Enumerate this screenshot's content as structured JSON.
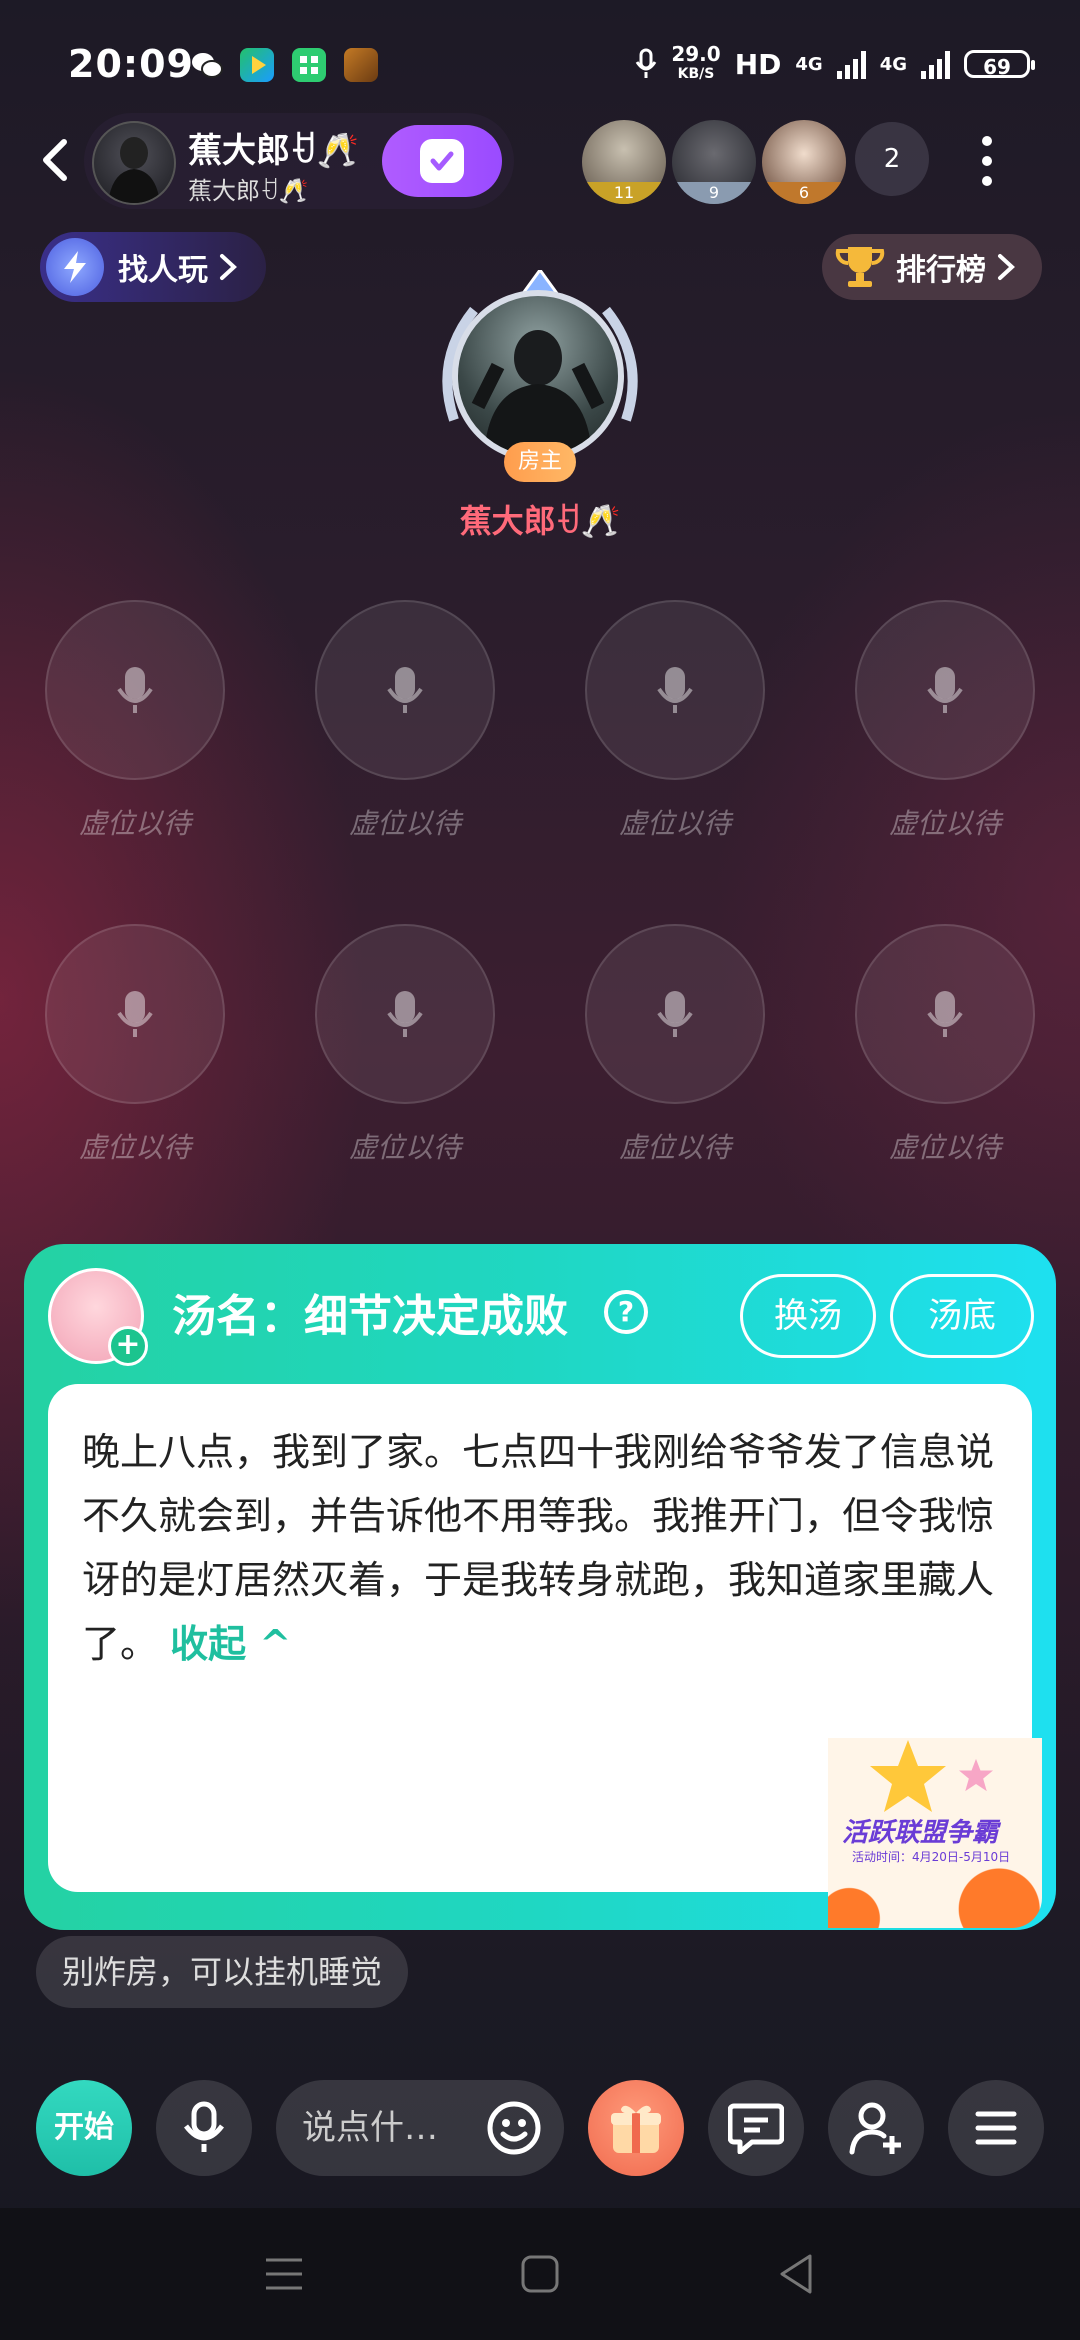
{
  "status_bar": {
    "time": "20:09",
    "net_speed_value": "29.0",
    "net_speed_unit": "KB/S",
    "hd": "HD",
    "net1": "4G",
    "net2": "4G",
    "battery": "69"
  },
  "header": {
    "owner_name": "蕉大郎ꀀ🥂",
    "owner_sub": "蕉大郎ꀀ🥂",
    "audience": [
      {
        "badge": "11",
        "color": "#c9a227"
      },
      {
        "badge": "9",
        "color": "#8a9bb0"
      },
      {
        "badge": "6",
        "color": "#c0782c"
      }
    ],
    "audience_count": "2"
  },
  "actions": {
    "find_players": "找人玩",
    "leaderboard": "排行榜"
  },
  "host": {
    "tag": "房主",
    "name": "蕉大郎ꀀ🥂"
  },
  "seats": [
    "虚位以待",
    "虚位以待",
    "虚位以待",
    "虚位以待",
    "虚位以待",
    "虚位以待",
    "虚位以待",
    "虚位以待"
  ],
  "game_card": {
    "title": "汤名：细节决定成败",
    "change_btn": "换汤",
    "answer_btn": "汤底",
    "story": "晚上八点，我到了家。七点四十我刚给爷爷发了信息说不久就会到，并告诉他不用等我。我推开门，但令我惊讶的是灯居然灭着，于是我转身就跑，我知道家里藏人了。",
    "collapse": "收起 ^",
    "promo_title": "活跃联盟争霸",
    "promo_sub": "活动时间：4月20日-5月10日"
  },
  "hint": "别炸房，可以挂机睡觉",
  "bottom_bar": {
    "start": "开始",
    "say_placeholder": "说点什…"
  },
  "colors": {
    "accent_green": "#1fd7c3",
    "follow_purple": "#a55bff",
    "host_name": "#ff6a7a"
  }
}
